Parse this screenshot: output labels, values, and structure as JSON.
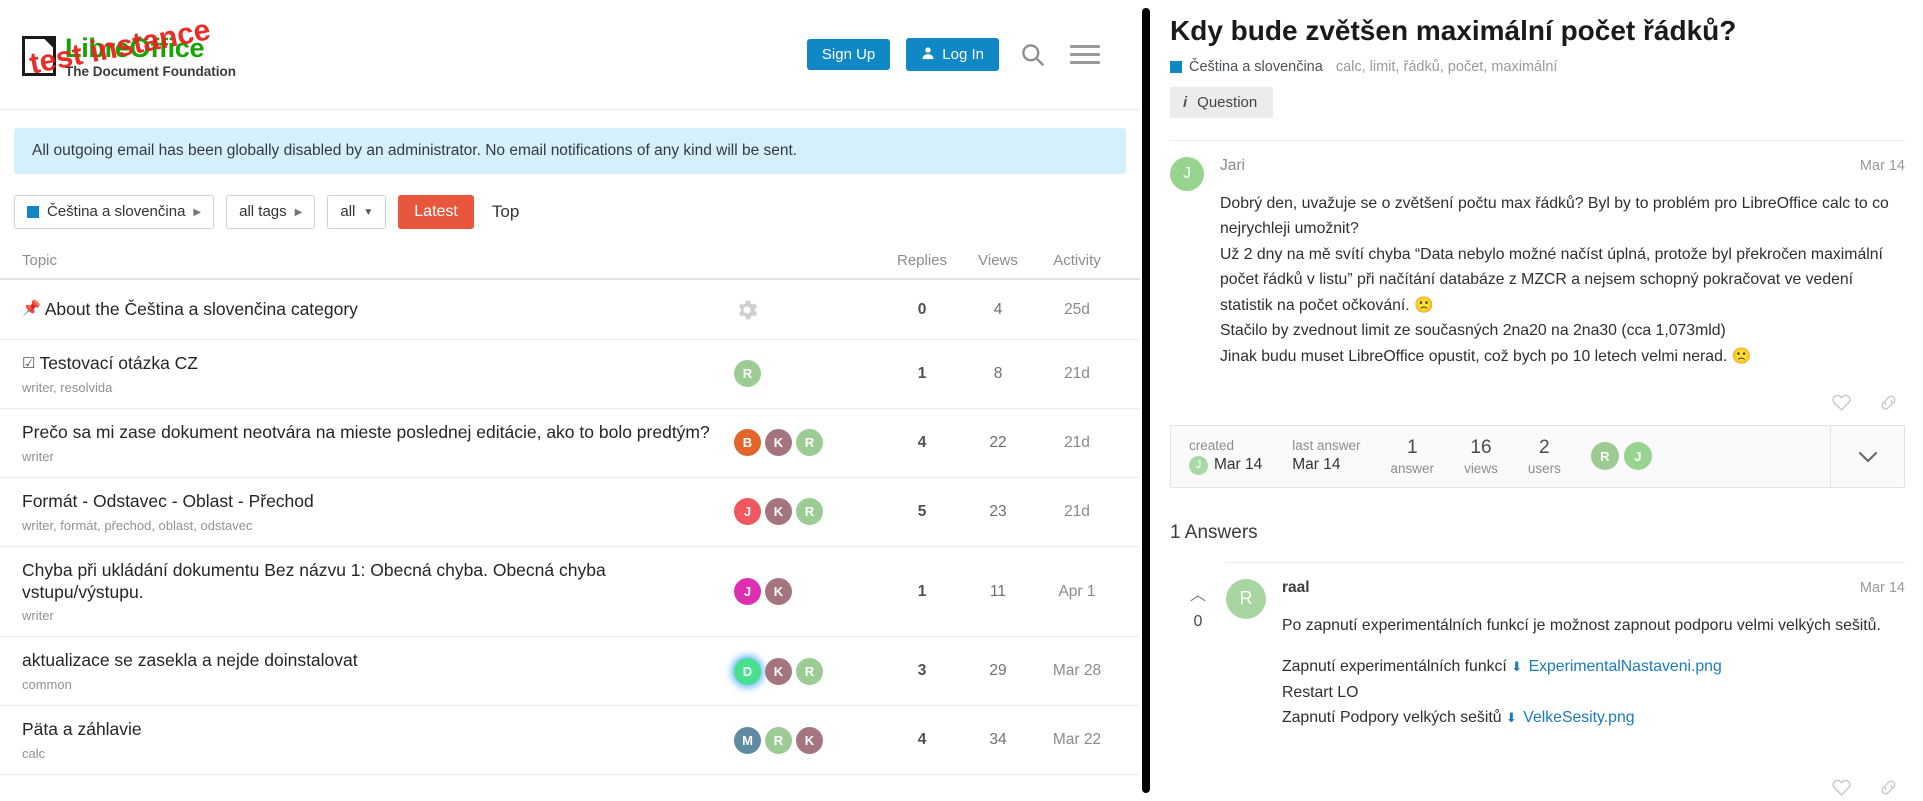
{
  "header": {
    "logo_title": "LibreOffice",
    "logo_subtitle": "The Document Foundation",
    "test_overlay": "test instance",
    "sign_up_label": "Sign Up",
    "log_in_label": "Log In",
    "search_icon": "search-icon",
    "menu_icon": "hamburger-menu-icon"
  },
  "notice": {
    "text": "All outgoing email has been globally disabled by an administrator. No email notifications of any kind will be sent."
  },
  "filters": {
    "category": "Čeština a slovenčina",
    "tags": "all tags",
    "scope": "all",
    "tab_latest": "Latest",
    "tab_top": "Top"
  },
  "topic_table": {
    "columns": {
      "topic": "Topic",
      "replies": "Replies",
      "views": "Views",
      "activity": "Activity"
    },
    "rows": [
      {
        "glyph": "📌",
        "title": "About the Čeština a slovenčina category",
        "tags": "",
        "avatars": [],
        "gear": true,
        "replies": "0",
        "views": "4",
        "activity": "25d"
      },
      {
        "glyph": "☑",
        "title": "Testovací otázka CZ",
        "tags": "writer, resolvida",
        "avatars": [
          {
            "letter": "R",
            "color": "#9ccb93"
          }
        ],
        "gear": false,
        "replies": "1",
        "views": "8",
        "activity": "21d"
      },
      {
        "glyph": "",
        "title": "Prečo sa mi zase dokument neotvára na mieste poslednej editácie, ako to bolo predtým?",
        "tags": "writer",
        "avatars": [
          {
            "letter": "B",
            "color": "#e2652a"
          },
          {
            "letter": "K",
            "color": "#a4757f"
          },
          {
            "letter": "R",
            "color": "#9ccb93"
          }
        ],
        "gear": false,
        "replies": "4",
        "views": "22",
        "activity": "21d"
      },
      {
        "glyph": "",
        "title": "Formát - Odstavec - Oblast - Přechod",
        "tags": "writer, formát, přechod, oblast, odstavec",
        "avatars": [
          {
            "letter": "J",
            "color": "#f0575e"
          },
          {
            "letter": "K",
            "color": "#a4757f"
          },
          {
            "letter": "R",
            "color": "#9ccb93"
          }
        ],
        "gear": false,
        "replies": "5",
        "views": "23",
        "activity": "21d"
      },
      {
        "glyph": "",
        "title": "Chyba při ukládání dokumentu Bez názvu 1: Obecná chyba. Obecná chyba vstupu/výstupu.",
        "tags": "writer",
        "avatars": [
          {
            "letter": "J",
            "color": "#dd2fb0"
          },
          {
            "letter": "K",
            "color": "#a4757f"
          }
        ],
        "gear": false,
        "replies": "1",
        "views": "11",
        "activity": "Apr 1"
      },
      {
        "glyph": "",
        "title": "aktualizace se zasekla a nejde doinstalovat",
        "tags": "common",
        "avatars": [
          {
            "letter": "D",
            "color": "#47e08e",
            "glow": true
          },
          {
            "letter": "K",
            "color": "#a4757f"
          },
          {
            "letter": "R",
            "color": "#9ccb93"
          }
        ],
        "gear": false,
        "replies": "3",
        "views": "29",
        "activity": "Mar 28"
      },
      {
        "glyph": "",
        "title": "Päta a záhlavie",
        "tags": "calc",
        "avatars": [
          {
            "letter": "M",
            "color": "#5e8ba2"
          },
          {
            "letter": "R",
            "color": "#9ccb93"
          },
          {
            "letter": "K",
            "color": "#a4757f"
          }
        ],
        "gear": false,
        "replies": "4",
        "views": "34",
        "activity": "Mar 22"
      }
    ]
  },
  "question": {
    "title": "Kdy bude zvětšen maximální počet řádků?",
    "category": "Čeština a slovenčina",
    "tags": "calc, limit, řádků, počet, maximální",
    "type_badge": "Question",
    "post": {
      "author": "Jari",
      "avatar_letter": "J",
      "date": "Mar 14",
      "lines": [
        "Dobrý den, uvažuje se o zvětšení počtu max řádků? Byl by to problém pro LibreOffice calc to co nejrychleji umožnit?",
        "Už 2 dny na mě svítí chyba “Data nebylo možné načíst úplná, protože byl překročen maximální počet řádků v listu” při načítání databáze z MZCR a nejsem schopný pokračovat ve vedení statistik na počet očkování. 🙁",
        "Stačilo by zvednout limit ze současných 2na20 na 2na30 (cca 1,073mld)",
        "Jinak budu muset LibreOffice opustit, což bych po 10 letech velmi nerad. 🙁"
      ],
      "like_icon": "heart-icon",
      "share_icon": "link-icon"
    },
    "summary": {
      "created_label": "created",
      "created_value": "Mar 14",
      "created_avatar": "J",
      "last_answer_label": "last answer",
      "last_answer_value": "Mar 14",
      "answers_count": "1",
      "answers_label": "answer",
      "views_count": "16",
      "views_label": "views",
      "users_count": "2",
      "users_label": "users",
      "user_avatars": [
        {
          "letter": "R",
          "color": "#9ccb93"
        },
        {
          "letter": "J",
          "color": "#96d490"
        }
      ],
      "expand_icon": "chevron-down-icon"
    },
    "answers_heading": "1 Answers",
    "answers": [
      {
        "vote_count": "0",
        "author": "raal",
        "avatar_letter": "R",
        "date": "Mar 14",
        "paragraph": "Po zapnutí experimentálních funkcí je možnost zapnout podporu velmi velkých sešitů.",
        "line_1_text": "Zapnutí experimentálních funkcí",
        "line_1_link": "ExperimentalNastaveni.png",
        "line_2_text": "Restart LO",
        "line_3_text": "Zapnutí Podpory velkých sešitů",
        "line_3_link": "VelkeSesity.png",
        "like_icon": "heart-icon",
        "share_icon": "link-icon"
      }
    ]
  },
  "colors": {
    "brand_blue": "#1088c6",
    "accent_orange": "#e8563d",
    "logo_green": "#18a303",
    "test_red": "#e8231e",
    "notice_bg": "#d6f0fb",
    "link_blue": "#1a7bbd"
  }
}
